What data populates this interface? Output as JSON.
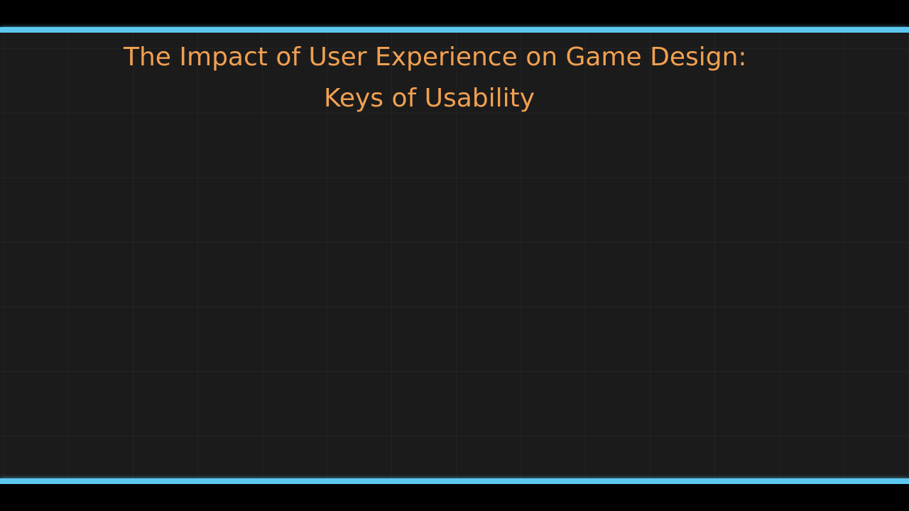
{
  "slide": {
    "title_line_1": "The Impact of User Experience on Game Design:",
    "title_line_2": "Keys of Usability"
  },
  "colors": {
    "background": "#000000",
    "stage": "#1b1b1c",
    "accent_lines": "#5cc8f0",
    "title_text": "#f0a050"
  }
}
